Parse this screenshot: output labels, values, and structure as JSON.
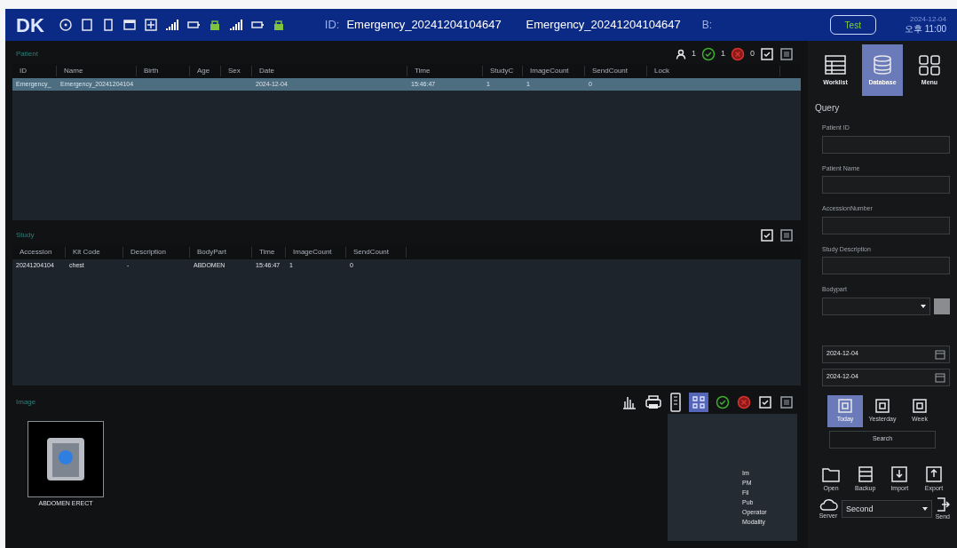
{
  "header": {
    "logo": "DK",
    "id_label": "ID:",
    "patient_id": "Emergency_20241204104647",
    "patient_name": "Emergency_20241204104647",
    "b_label": "B:",
    "mode_button": "Test",
    "date": "2024-12-04",
    "time": "오후 11:00"
  },
  "patient": {
    "title": "Patient",
    "counts": [
      "1",
      "1",
      "0"
    ],
    "columns": [
      "ID",
      "Name",
      "Birth",
      "Age",
      "Sex",
      "Date",
      "Time",
      "StudyC",
      "ImageCount",
      "SendCount",
      "Lock"
    ],
    "rows": [
      {
        "selected": true,
        "cells": [
          "Emergency_",
          "Emergency_20241204104",
          "",
          "",
          "",
          "2024-12-04",
          "15:46:47",
          "1",
          "1",
          "0",
          ""
        ]
      }
    ]
  },
  "study": {
    "title": "Study",
    "columns": [
      "Accession",
      "Kit Code",
      "Description",
      "BodyPart",
      "Time",
      "ImageCount",
      "SendCount"
    ],
    "rows": [
      {
        "selected": false,
        "cells": [
          "20241204104",
          "chest",
          "-",
          "ABDOMEN",
          "15:46:47",
          "1",
          "0"
        ]
      }
    ]
  },
  "image": {
    "title": "Image",
    "thumbnails": [
      {
        "label": "ABDOMEN ERECT",
        "selected": true
      }
    ],
    "info": [
      "Im",
      "PM",
      "Fil",
      "Pub",
      "Operator",
      "Modality"
    ]
  },
  "sidebar": {
    "tabs": [
      {
        "label": "Worklist",
        "selected": false
      },
      {
        "label": "Database",
        "selected": true
      },
      {
        "label": "Menu",
        "selected": false
      }
    ],
    "query_title": "Query",
    "fields": [
      {
        "label": "Patient ID"
      },
      {
        "label": "Patient Name"
      },
      {
        "label": "AccessionNumber"
      },
      {
        "label": "Study Description"
      }
    ],
    "bodypart_label": "Bodypart",
    "dates": [
      "2024-12-04",
      "2024-12-04"
    ],
    "ranges": [
      {
        "label": "Today",
        "selected": true
      },
      {
        "label": "Yesterday",
        "selected": false
      },
      {
        "label": "Week",
        "selected": false
      }
    ],
    "search_button": "Search",
    "actions": [
      "Open",
      "Backup",
      "Import",
      "Export"
    ],
    "server_label": "Server",
    "server_value": "Second",
    "send_label": "Send"
  }
}
